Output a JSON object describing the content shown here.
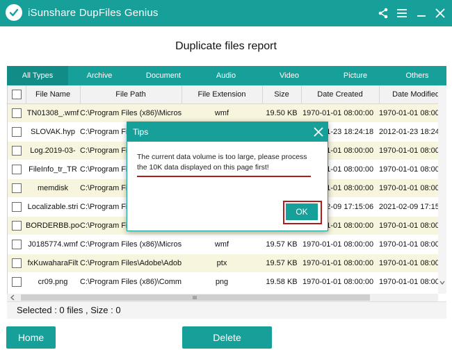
{
  "app": {
    "title": "iSunshare DupFiles Genius"
  },
  "report": {
    "title": "Duplicate files report"
  },
  "tabs": [
    "All Types",
    "Archive",
    "Document",
    "Audio",
    "Video",
    "Picture",
    "Others"
  ],
  "table": {
    "headers": [
      "File Name",
      "File Path",
      "File Extension",
      "Size",
      "Date Created",
      "Date Modified"
    ],
    "rows": [
      {
        "name": "TN01308_.wmf",
        "path": "C:\\Program Files (x86)\\Micros",
        "ext": "wmf",
        "size": "19.50 KB",
        "created": "1970-01-01 08:00:00",
        "modified": "1970-01-01 08:00:0"
      },
      {
        "name": "SLOVAK.hyp",
        "path": "C:\\Program Files (x86)\\",
        "ext": "",
        "size": "",
        "created": "2012-01-23 18:24:18",
        "modified": "2012-01-23 18:24:1"
      },
      {
        "name": "Log.2019-03-",
        "path": "C:\\Program Files (x86)\\",
        "ext": "",
        "size": "",
        "created": "1970-01-01 08:00:00",
        "modified": "1970-01-01 08:00:0"
      },
      {
        "name": "FileInfo_tr_TR",
        "path": "C:\\Program Files (x86)\\",
        "ext": "",
        "size": "",
        "created": "1970-01-01 08:00:00",
        "modified": "1970-01-01 08:00:0"
      },
      {
        "name": "memdisk",
        "path": "C:\\Program Files (x86)\\",
        "ext": "",
        "size": "",
        "created": "1970-01-01 08:00:00",
        "modified": "1970-01-01 08:00:0"
      },
      {
        "name": "Localizable.stri",
        "path": "C:\\Program Files (x86)\\",
        "ext": "",
        "size": "",
        "created": "2021-02-09 17:15:06",
        "modified": "2021-02-09 17:15:0"
      },
      {
        "name": "BORDERBB.poc",
        "path": "C:\\Program Files (x86)\\",
        "ext": "",
        "size": "",
        "created": "1970-01-01 08:00:00",
        "modified": "1970-01-01 08:00:0"
      },
      {
        "name": "J0185774.wmf",
        "path": "C:\\Program Files (x86)\\Micros",
        "ext": "wmf",
        "size": "19.57 KB",
        "created": "1970-01-01 08:00:00",
        "modified": "1970-01-01 08:00:0"
      },
      {
        "name": "fxKuwaharaFilt",
        "path": "C:\\Program Files\\Adobe\\Adobe",
        "ext": "ptx",
        "size": "19.57 KB",
        "created": "1970-01-01 08:00:00",
        "modified": "1970-01-01 08:00:0"
      },
      {
        "name": "cr09.png",
        "path": "C:\\Program Files (x86)\\Comm",
        "ext": "png",
        "size": "19.58 KB",
        "created": "1970-01-01 08:00:00",
        "modified": "1970-01-01 08:00:0"
      }
    ]
  },
  "status": {
    "text": "Selected : 0  files ,  Size : 0"
  },
  "buttons": {
    "home": "Home",
    "delete": "Delete"
  },
  "dialog": {
    "title": "Tips",
    "message": "The current data volume is too large, please process the 10K data displayed on this page first!",
    "ok": "OK"
  }
}
